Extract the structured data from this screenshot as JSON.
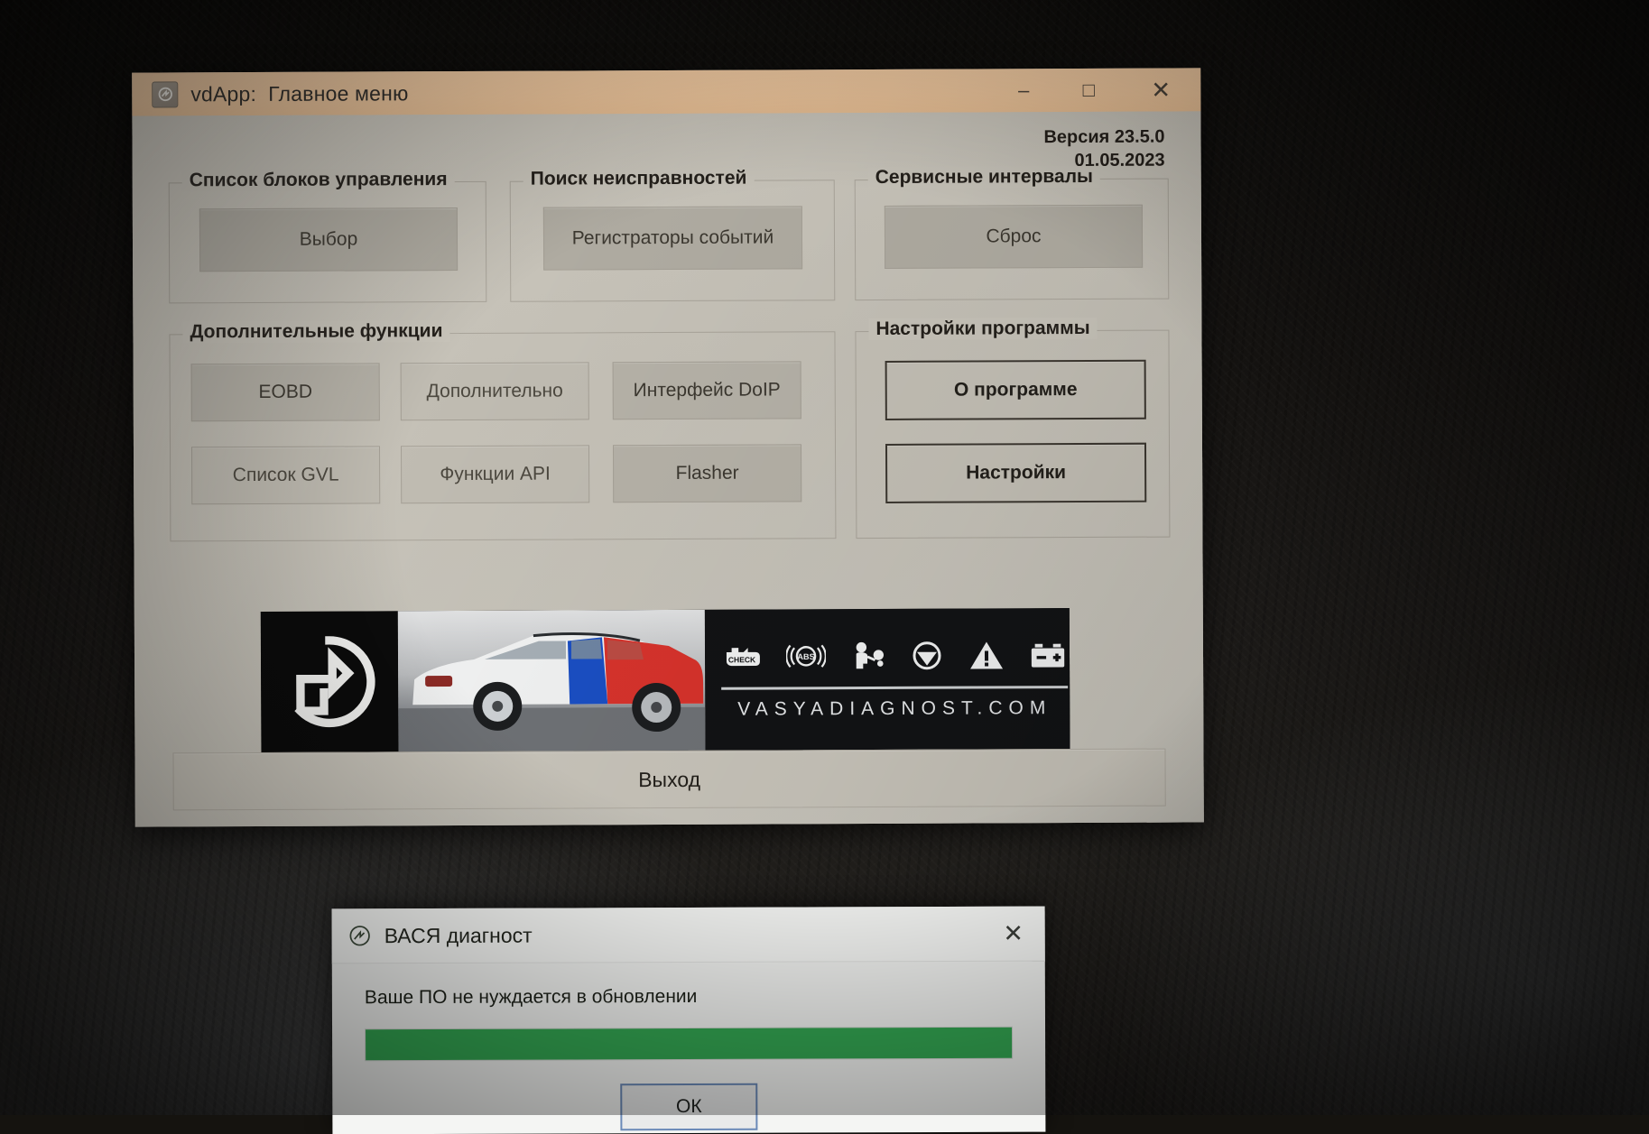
{
  "window": {
    "icon": "app-logo-icon",
    "title": "vdApp:  Главное меню",
    "minimize": "–",
    "maximize": "□",
    "close": "✕"
  },
  "version": {
    "number": "Версия 23.5.0",
    "date": "01.05.2023"
  },
  "groups": {
    "ecu_list": {
      "legend": "Список блоков управления",
      "button": "Выбор"
    },
    "fault_search": {
      "legend": "Поиск неисправностей",
      "button": "Регистраторы событий"
    },
    "service_intervals": {
      "legend": "Сервисные интервалы",
      "button": "Сброс"
    },
    "extra_functions": {
      "legend": "Дополнительные функции",
      "buttons": [
        "EOBD",
        "Дополнительно",
        "Интерфейс DoIP",
        "Список GVL",
        "Функции API",
        "Flasher"
      ]
    },
    "program_settings": {
      "legend": "Настройки программы",
      "buttons": [
        "О программе",
        "Настройки"
      ]
    }
  },
  "banner": {
    "logo": "vasya-diagnost-logo-icon",
    "car_image": "skoda-car-photo",
    "icons": [
      "check-engine-icon",
      "abs-icon",
      "airbag-icon",
      "steering-wheel-icon",
      "warning-triangle-icon",
      "battery-icon"
    ],
    "check_label": "CHECK",
    "abs_label": "ABS",
    "url": "VASYADIAGNOST.COM"
  },
  "exit_button": "Выход",
  "dialog": {
    "icon": "vasya-diagnost-icon",
    "title": "ВАСЯ диагност",
    "close": "✕",
    "message": "Ваше ПО не нуждается в обновлении",
    "progress_percent": 100,
    "ok_button": "ОК"
  },
  "colors": {
    "titlebar": "#eec69c",
    "window_face": "#c8c4ba",
    "button_face": "#b0aca2",
    "progress_green": "#34a853",
    "focus_blue": "#6b8ab8",
    "banner_black": "#0c0c0c"
  }
}
